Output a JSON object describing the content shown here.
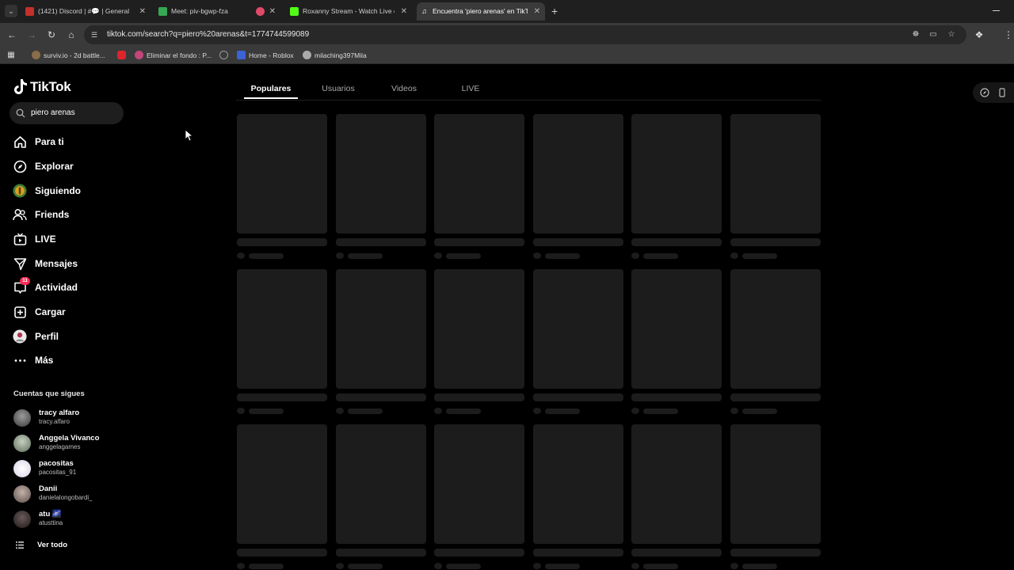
{
  "browser": {
    "tabs": [
      {
        "title": "(1421) Discord | #💬 | General",
        "icon_color": "#c4302b",
        "active": false
      },
      {
        "title": "Meet: piv-bgwp-fza",
        "icon_color": "#34a853",
        "active": false
      },
      {
        "title": "",
        "icon_color": "#e04a6a",
        "active": false
      },
      {
        "title": "Roxanny Stream - Watch Live on Kick",
        "icon_color": "#53fc18",
        "active": false
      },
      {
        "title": "Encuentra 'piero arenas' en TikTok",
        "icon_color": "#ffffff",
        "active": true
      }
    ],
    "close_glyph": "✕",
    "new_tab_glyph": "+",
    "url": "tiktok.com/search?q=piero%20arenas&t=1774744599089",
    "bookmarks": [
      {
        "label": "surviv.io - 2d battle...",
        "icon_color": "#8a6d4a"
      },
      {
        "label": "",
        "icon_color": "#e0242c"
      },
      {
        "label": "Eliminar el fondo : P...",
        "icon_color": "#c2467a"
      },
      {
        "label": "",
        "icon_color": "#777777"
      },
      {
        "label": "Home - Roblox",
        "icon_color": "#3b63d6"
      },
      {
        "label": "milaching397Mila",
        "icon_color": "#aaaaaa"
      }
    ]
  },
  "tiktok": {
    "logo_text": "TikTok",
    "search_value": "piero arenas",
    "nav": [
      {
        "label": "Para ti",
        "icon": "home-icon"
      },
      {
        "label": "Explorar",
        "icon": "compass-icon"
      },
      {
        "label": "Siguiendo",
        "icon": "following-avatar-icon"
      },
      {
        "label": "Friends",
        "icon": "friends-icon"
      },
      {
        "label": "LIVE",
        "icon": "live-tv-icon"
      },
      {
        "label": "Mensajes",
        "icon": "send-icon"
      },
      {
        "label": "Actividad",
        "icon": "activity-icon",
        "badge": "11"
      },
      {
        "label": "Cargar",
        "icon": "upload-icon"
      },
      {
        "label": "Perfil",
        "icon": "profile-avatar-icon"
      },
      {
        "label": "Más",
        "icon": "more-icon"
      }
    ],
    "following_title": "Cuentas que sigues",
    "following": [
      {
        "name": "tracy alfaro",
        "username": "tracy.alfaro",
        "avatar_color": "#5b5b5b"
      },
      {
        "name": "Anggela Vivanco",
        "username": "anggelagames",
        "avatar_color": "#7a8a7a"
      },
      {
        "name": "pacositas",
        "username": "pacositas_91",
        "avatar_color": "#d9d2e6"
      },
      {
        "name": "Danii",
        "username": "danielalongobardi_",
        "avatar_color": "#8a7d78"
      },
      {
        "name": "atu 🌌",
        "username": "atusttina",
        "avatar_color": "#3a3030"
      }
    ],
    "see_all": "Ver todo",
    "search_tabs": [
      "Populares",
      "Usuarios",
      "Videos",
      "LIVE"
    ],
    "active_tab": "Populares",
    "placeholder_rows": 3,
    "placeholder_cols": 6
  }
}
